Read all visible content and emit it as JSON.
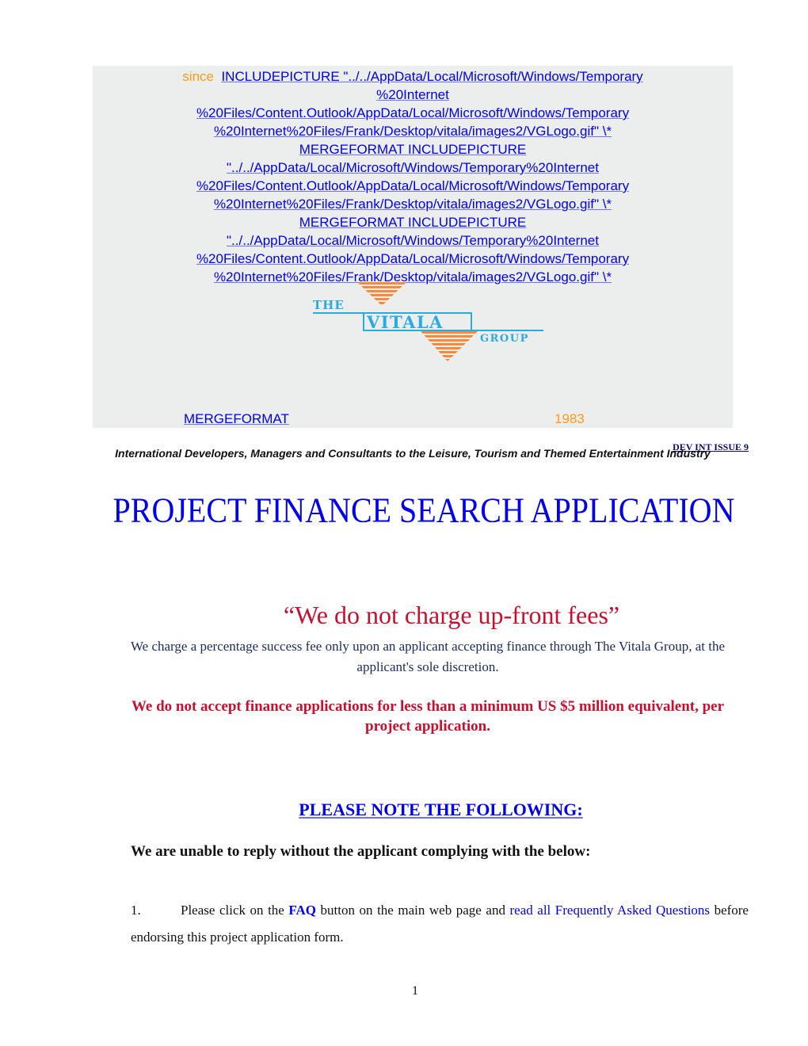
{
  "header": {
    "since_label": "since",
    "field_code_lines": [
      "INCLUDEPICTURE \"../../AppData/Local/Microsoft/Windows/Temporary",
      "%20Internet",
      "%20Files/Content.Outlook/AppData/Local/Microsoft/Windows/Temporary",
      "%20Internet%20Files/Frank/Desktop/vitala/images2/VGLogo.gif\" \\*",
      "MERGEFORMAT  INCLUDEPICTURE",
      "\"../../AppData/Local/Microsoft/Windows/Temporary%20Internet",
      "%20Files/Content.Outlook/AppData/Local/Microsoft/Windows/Temporary",
      "%20Internet%20Files/Frank/Desktop/vitala/images2/VGLogo.gif\" \\*",
      "MERGEFORMAT  INCLUDEPICTURE",
      "\"../../AppData/Local/Microsoft/Windows/Temporary%20Internet",
      "%20Files/Content.Outlook/AppData/Local/Microsoft/Windows/Temporary",
      "%20Internet%20Files/Frank/Desktop/vitala/images2/VGLogo.gif\" \\*"
    ],
    "merge_label": "MERGEFORMAT ",
    "year": "1983",
    "logo": {
      "the": "THE",
      "name": "VITALA",
      "group": "GROUP",
      "colors": {
        "blue": "#29abe2",
        "orange": "#f58a3c"
      }
    },
    "tagline": "International Developers, Managers and Consultants to the Leisure, Tourism and Themed Entertainment Industry"
  },
  "issue_label": "DEV INT ISSUE 9",
  "title": "PROJECT FINANCE SEARCH APPLICATION",
  "quote": "“We do not charge up-front fees”",
  "fee_paragraph": "We charge a percentage success fee only upon an applicant accepting finance through The Vitala Group, at the applicant's sole discretion.",
  "minimum_paragraph": "We do not accept finance applications for less than a minimum US $5 million equivalent, per project application.",
  "note_heading": "PLEASE NOTE THE FOLLOWING:",
  "unable_text": "We are unable to reply without the applicant complying with the below:",
  "items": [
    {
      "number": "1.",
      "text_before": "Please click on the ",
      "faq_label": "FAQ",
      "text_middle": " button on the main web page and ",
      "link_text": "read all Frequently Asked Questions",
      "text_after": " before endorsing this project application form."
    }
  ],
  "page_number": "1",
  "colors": {
    "link": "#0000ee",
    "accent_red": "#c8102e",
    "orange": "#ff9a1a",
    "header_bg": "#eceeee"
  }
}
